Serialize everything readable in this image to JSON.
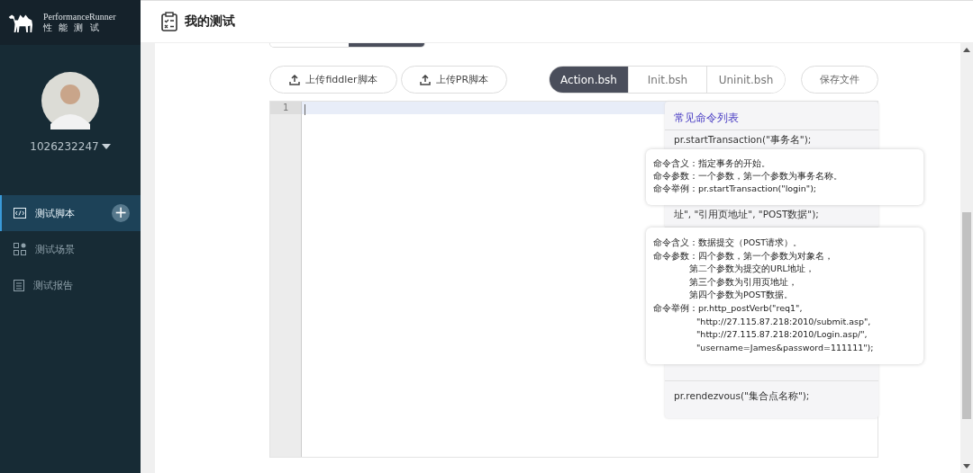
{
  "brand": {
    "name": "PerformanceRunner",
    "subtitle": "性 能 测 试"
  },
  "user": {
    "name": "1026232247"
  },
  "sidebar": {
    "items": [
      {
        "label": "测试脚本",
        "kind": "script",
        "selected": true,
        "add_button": "+"
      },
      {
        "label": "测试场景",
        "kind": "scene",
        "selected": false
      },
      {
        "label": "测试报告",
        "kind": "report",
        "selected": false
      }
    ]
  },
  "header": {
    "title": "我的测试"
  },
  "upload_buttons": [
    "上传fiddler脚本",
    "上传PR脚本"
  ],
  "file_tabs": [
    {
      "label": "Action.bsh",
      "selected": true
    },
    {
      "label": "Init.bsh",
      "selected": false
    },
    {
      "label": "Uninit.bsh",
      "selected": false
    }
  ],
  "save_button": "保存文件",
  "editor": {
    "line_numbers": [
      "1"
    ]
  },
  "command_panel": {
    "title": "常见命令列表",
    "commands": [
      {
        "text": "pr.startTransaction(\"事务名\");",
        "kind": "full"
      },
      {
        "text": "址\", \"引用页地址\", \"POST数据\");",
        "kind": "partial"
      },
      {
        "text": "pr.rendezvous(\"集合点名称\");",
        "kind": "full"
      }
    ]
  },
  "tooltips": [
    {
      "lines": [
        "命令含义：指定事务的开始。",
        "命令参数：一个参数，第一个参数为事务名称。",
        "命令举例：pr.startTransaction(\"login\");"
      ]
    },
    {
      "lines": [
        {
          "text": "命令含义：数据提交（POST请求）。",
          "kind": "head"
        },
        {
          "text": "命令参数：四个参数，第一个参数为对象名，",
          "kind": "head"
        },
        {
          "text": "第二个参数为提交的URL地址，",
          "kind": "param"
        },
        {
          "text": "第三个参数为引用页地址，",
          "kind": "param"
        },
        {
          "text": "第四个参数为POST数据。",
          "kind": "param"
        },
        {
          "text": "命令举例：pr.http_postVerb(\"req1\",",
          "kind": "head"
        },
        {
          "text": "\"http://27.115.87.218:2010/submit.asp\",",
          "kind": "example"
        },
        {
          "text": "\"http://27.115.87.218:2010/Login.asp/\",",
          "kind": "example"
        },
        {
          "text": "\"username=James&password=111111\");",
          "kind": "example"
        }
      ]
    }
  ]
}
